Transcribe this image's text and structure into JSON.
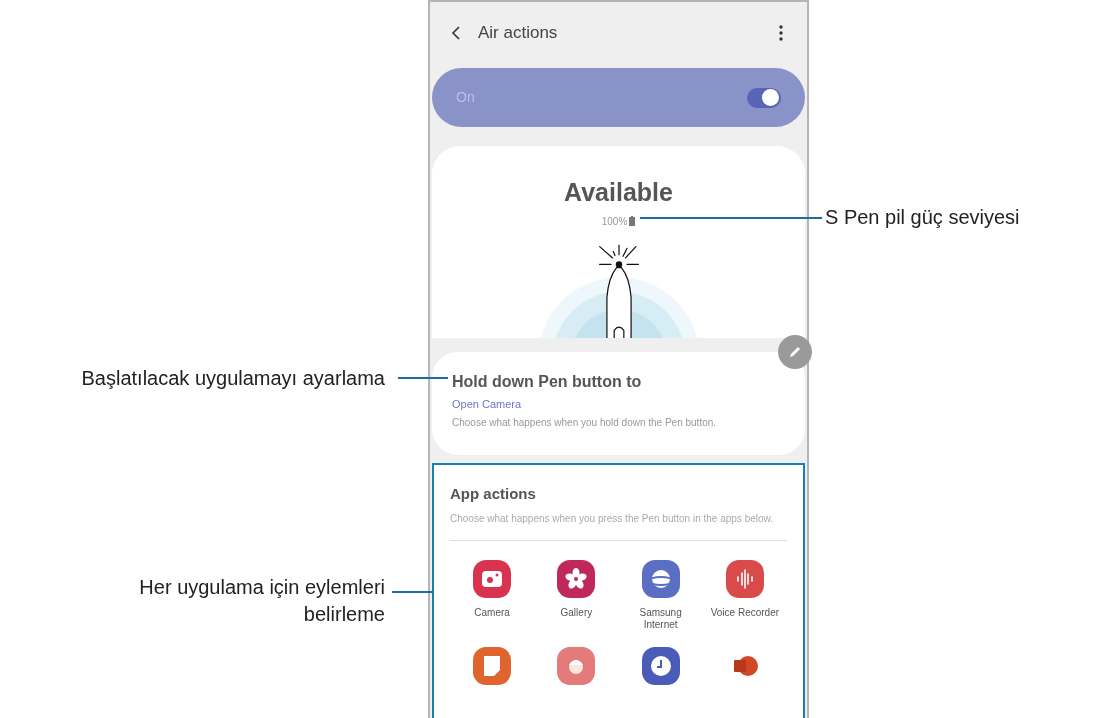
{
  "screen": {
    "title": "Air actions",
    "master_switch": {
      "label": "On",
      "on": true
    },
    "status": {
      "heading": "Available",
      "battery": "100%"
    },
    "hold_card": {
      "title": "Hold down Pen button to",
      "value": "Open Camera",
      "description": "Choose what happens when you hold down the Pen button."
    },
    "app_actions": {
      "title": "App actions",
      "description": "Choose what happens when you press the Pen button in the apps below.",
      "apps": [
        {
          "name": "Camera",
          "kind": "camera",
          "color": "#d8334f"
        },
        {
          "name": "Gallery",
          "kind": "gallery",
          "color": "#c0285a"
        },
        {
          "name": "Samsung Internet",
          "kind": "internet",
          "color": "#5a6fc4"
        },
        {
          "name": "Voice Recorder",
          "kind": "recorder",
          "color": "#d94a4a"
        },
        {
          "kind": "notes",
          "color": "#e0642e"
        },
        {
          "kind": "face",
          "color": "#e57a7a"
        },
        {
          "kind": "clock",
          "color": "#4a5cb8"
        },
        {
          "kind": "slides",
          "color": "#d24726"
        }
      ]
    }
  },
  "callouts": [
    {
      "text": "S Pen pil güç seviyesi"
    },
    {
      "text": "Başlatılacak uygulamayı ayarlama"
    },
    {
      "text": "Her uygulama için eylemleri belirleme"
    }
  ]
}
